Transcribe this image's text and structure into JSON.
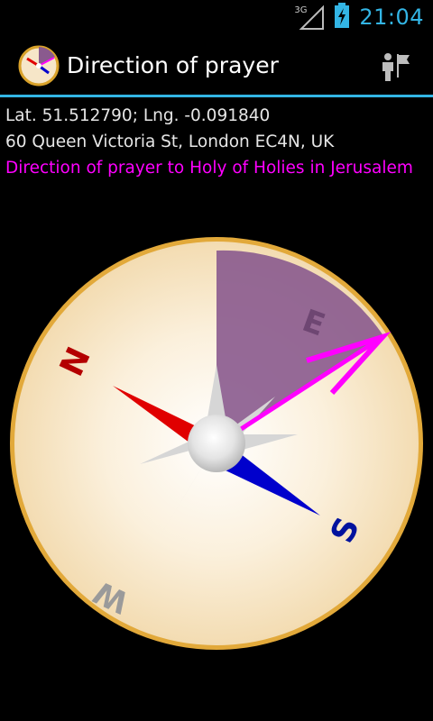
{
  "status_bar": {
    "network": "3G",
    "time": "21:04"
  },
  "action_bar": {
    "title": "Direction of prayer",
    "action_icon": "person-flag-icon",
    "divider_color": "#33b5e5"
  },
  "info": {
    "coordinates": "Lat. 51.512790; Lng. -0.091840",
    "address": "60 Queen Victoria St, London EC4N, UK",
    "prayer_direction": "Direction of prayer to Holy of Holies in Jerusalem"
  },
  "compass": {
    "labels": {
      "north": "N",
      "east": "E",
      "south": "S",
      "west": "W"
    },
    "prayer_bearing_deg": 115,
    "colors": {
      "north_needle": "#e00000",
      "south_needle": "#0000cc",
      "prayer_arrow": "#ff00ff",
      "prayer_sector": "#8a5a8e",
      "rim": "#d9a22a"
    }
  }
}
